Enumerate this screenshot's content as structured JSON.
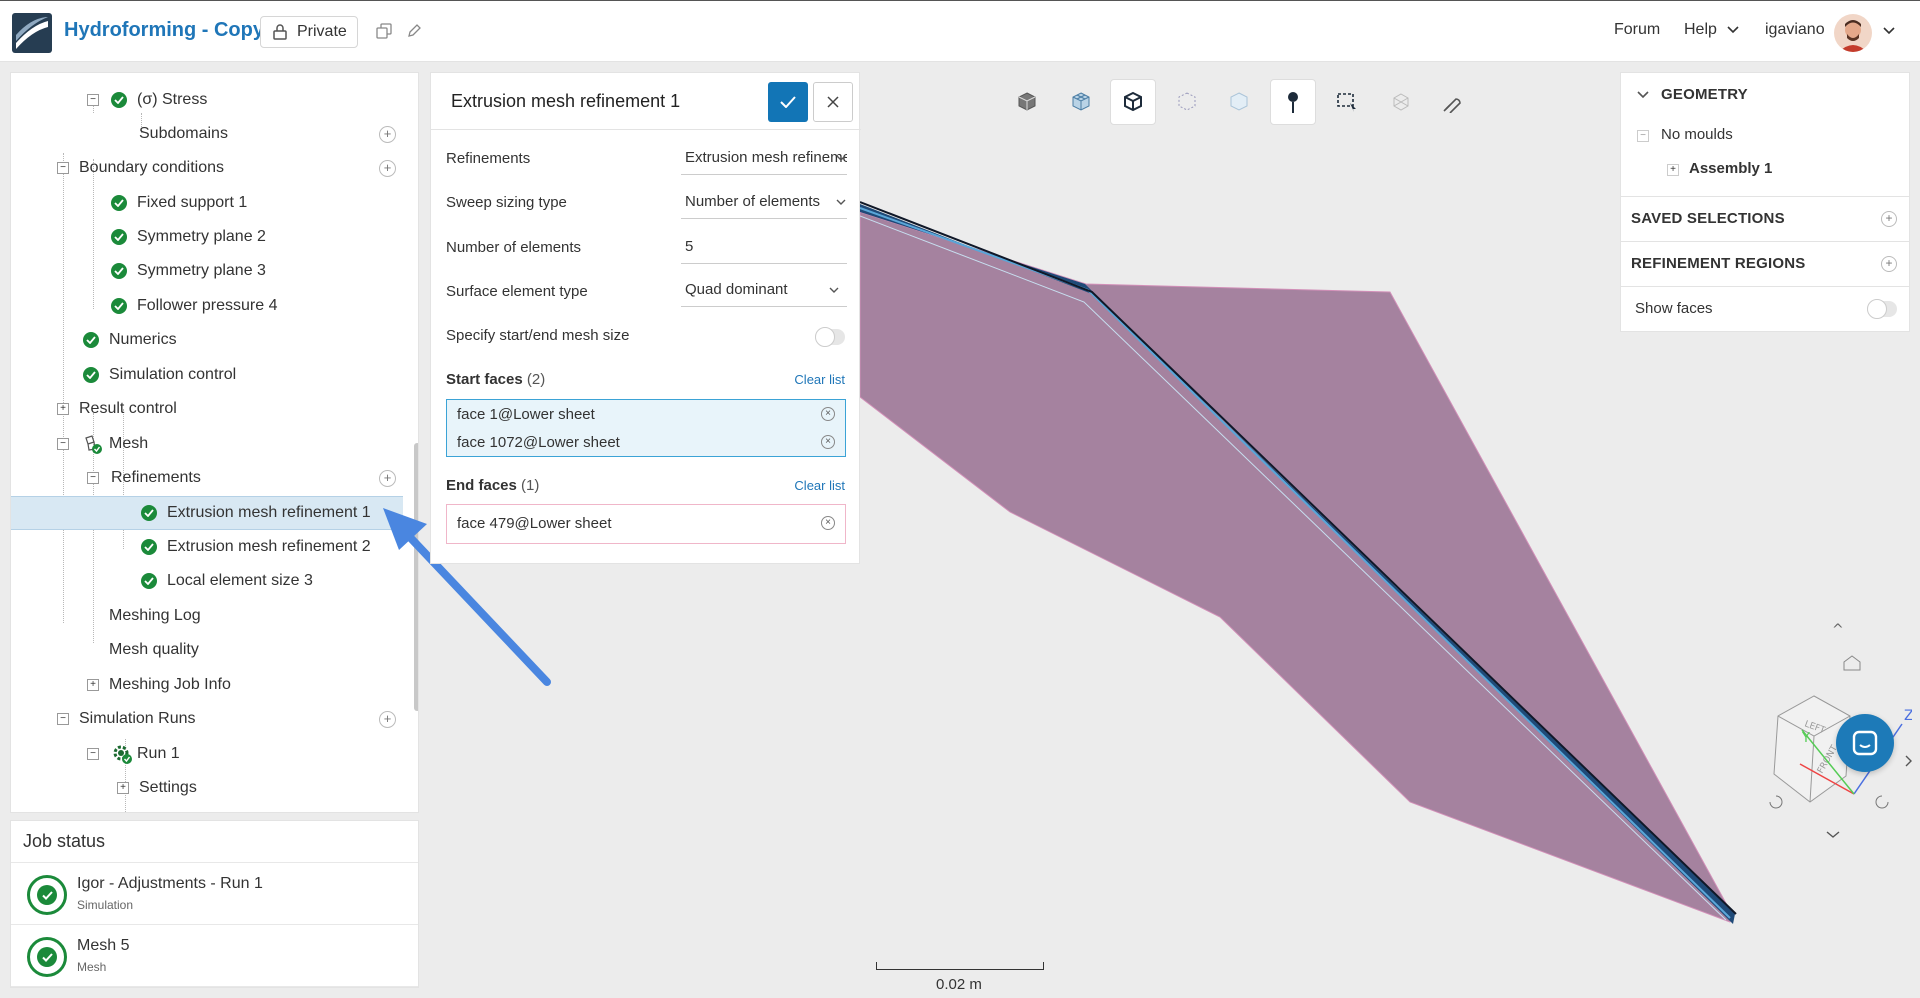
{
  "app": {
    "project_title": "Hydroforming - Copy",
    "visibility": "Private",
    "nav": {
      "forum": "Forum",
      "help": "Help",
      "username": "igaviano"
    }
  },
  "tree": {
    "items": [
      {
        "label": "(σ) Stress",
        "status": "ok"
      },
      {
        "label": "Subdomains"
      },
      {
        "label": "Boundary conditions"
      },
      {
        "label": "Fixed support 1",
        "status": "ok"
      },
      {
        "label": "Symmetry plane 2",
        "status": "ok"
      },
      {
        "label": "Symmetry plane 3",
        "status": "ok"
      },
      {
        "label": "Follower pressure 4",
        "status": "ok"
      },
      {
        "label": "Numerics",
        "status": "ok"
      },
      {
        "label": "Simulation control",
        "status": "ok"
      },
      {
        "label": "Result control"
      },
      {
        "label": "Mesh",
        "status": "ok"
      },
      {
        "label": "Refinements"
      },
      {
        "label": "Extrusion mesh refinement 1",
        "status": "ok",
        "selected": true
      },
      {
        "label": "Extrusion mesh refinement 2",
        "status": "ok"
      },
      {
        "label": "Local element size 3",
        "status": "ok"
      },
      {
        "label": "Meshing Log"
      },
      {
        "label": "Mesh quality"
      },
      {
        "label": "Meshing Job Info"
      },
      {
        "label": "Simulation Runs"
      },
      {
        "label": "Run 1",
        "status": "ok"
      },
      {
        "label": "Settings"
      }
    ]
  },
  "job_status": {
    "title": "Job status",
    "jobs": [
      {
        "title": "Igor - Adjustments - Run 1",
        "type": "Simulation"
      },
      {
        "title": "Mesh 5",
        "type": "Mesh"
      }
    ]
  },
  "dialog": {
    "title": "Extrusion mesh refinement 1",
    "fields": [
      {
        "label": "Refinements",
        "value": "Extrusion mesh refinement"
      },
      {
        "label": "Sweep sizing type",
        "value": "Number of elements"
      },
      {
        "label": "Number of elements",
        "value": "5"
      },
      {
        "label": "Surface element type",
        "value": "Quad dominant"
      },
      {
        "label": "Specify start/end mesh size"
      }
    ],
    "start_faces": {
      "label": "Start faces",
      "count": "(2)",
      "clear": "Clear list",
      "items": [
        "face 1@Lower sheet",
        "face 1072@Lower sheet"
      ]
    },
    "end_faces": {
      "label": "End faces",
      "count": "(1)",
      "clear": "Clear list",
      "items": [
        "face 479@Lower sheet"
      ]
    }
  },
  "right_panel": {
    "geometry": "GEOMETRY",
    "no_moulds": "No moulds",
    "assembly": "Assembly 1",
    "saved_selections": "SAVED SELECTIONS",
    "refinement_regions": "REFINEMENT REGIONS",
    "show_faces": "Show faces"
  },
  "viewport": {
    "scale_label": "0.02 m",
    "cube_faces": [
      "LEFT",
      "FRONT"
    ],
    "axes": [
      "Z",
      "Y"
    ]
  },
  "colors": {
    "brand": "#1f76b8",
    "success": "#1b8a3a",
    "primary_button": "#1275b6",
    "mesh_fill": "#a5829f",
    "annotation_arrow": "#4a86e0"
  }
}
